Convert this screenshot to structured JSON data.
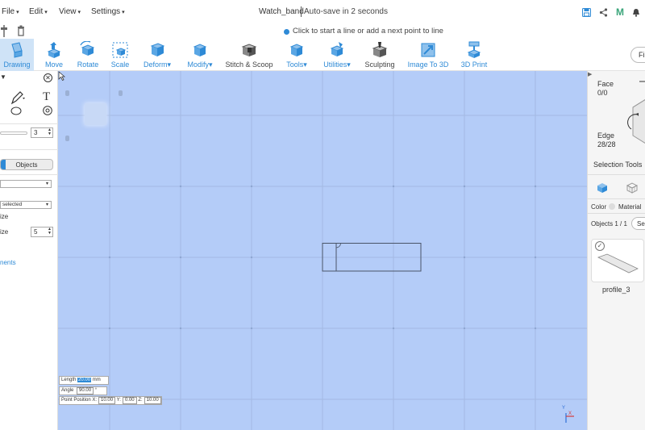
{
  "menus": [
    {
      "label": "File"
    },
    {
      "label": "Edit"
    },
    {
      "label": "View"
    },
    {
      "label": "Settings"
    }
  ],
  "document": {
    "title": "Watch_band",
    "autosave": "Auto-save in 2 seconds"
  },
  "hint": "Click to start a line or add a next point to line",
  "tools": [
    {
      "label": "Drawing",
      "icon": "drawing-icon"
    },
    {
      "label": "Move",
      "icon": "move-icon"
    },
    {
      "label": "Rotate",
      "icon": "rotate-icon"
    },
    {
      "label": "Scale",
      "icon": "scale-icon"
    },
    {
      "label": "Deform",
      "icon": "deform-icon"
    },
    {
      "label": "Modify",
      "icon": "modify-icon"
    },
    {
      "label": "Stitch & Scoop",
      "icon": "stitch-scoop-icon"
    },
    {
      "label": "Tools",
      "icon": "tools-icon"
    },
    {
      "label": "Utilities",
      "icon": "utilities-icon"
    },
    {
      "label": "Sculpting",
      "icon": "sculpting-icon"
    },
    {
      "label": "Image To 3D",
      "icon": "image-to-3d-icon"
    },
    {
      "label": "3D Print",
      "icon": "3d-print-icon"
    }
  ],
  "find_label": "Fi",
  "left_panel": {
    "text_tool_glyph": "T",
    "thickness_value": "3",
    "objects_tab": "Objects",
    "selection_dropdown": "selected",
    "size_label": "ize",
    "grid_size_label": "ize",
    "grid_size_value": "5",
    "link_text": "nents"
  },
  "readouts": {
    "length_label": "Length",
    "length_value": "20.00",
    "length_unit": "mm",
    "angle_label": "Angle",
    "angle_value": "90.00",
    "angle_unit": "°",
    "point_label": "Point Position",
    "x_label": "X:",
    "x_value": "10.00",
    "y_label": "Y:",
    "y_value": "0.00",
    "z_label": "Z:",
    "z_value": "10.00"
  },
  "axis": {
    "x": "X",
    "y": "Y"
  },
  "right_panel": {
    "face_label": "Face",
    "face_count": "0/0",
    "edge_label": "Edge",
    "edge_count": "28/28",
    "selection_tools": "Selection Tools",
    "color_label": "Color",
    "material_label": "Material",
    "objects_count": "Objects 1 / 1",
    "search_label": "Sea",
    "object_name": "profile_3"
  },
  "colors": {
    "accent": "#2e8ad6",
    "canvas": "#b4ccf8",
    "grid": "#a3b9e3"
  }
}
